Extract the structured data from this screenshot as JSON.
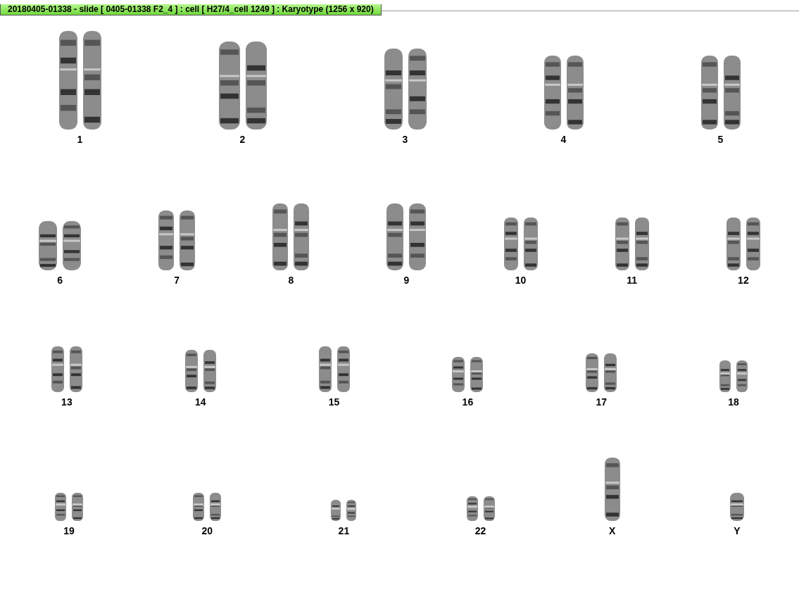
{
  "window": {
    "title": "20180405-01338 - slide [ 0405-01338 F2_4 ] : cell [ H27/4_cell 1249 ] : Karyotype  (1256 x 920)"
  },
  "karyotype": {
    "rows": [
      [
        {
          "label": "1",
          "kind": "pair"
        },
        {
          "label": "2",
          "kind": "pair"
        },
        {
          "label": "3",
          "kind": "pair"
        },
        {
          "label": "4",
          "kind": "pair"
        },
        {
          "label": "5",
          "kind": "pair"
        }
      ],
      [
        {
          "label": "6",
          "kind": "pair"
        },
        {
          "label": "7",
          "kind": "pair"
        },
        {
          "label": "8",
          "kind": "pair"
        },
        {
          "label": "9",
          "kind": "pair"
        },
        {
          "label": "10",
          "kind": "pair"
        },
        {
          "label": "11",
          "kind": "pair"
        },
        {
          "label": "12",
          "kind": "pair"
        }
      ],
      [
        {
          "label": "13",
          "kind": "pair"
        },
        {
          "label": "14",
          "kind": "pair"
        },
        {
          "label": "15",
          "kind": "pair"
        },
        {
          "label": "16",
          "kind": "pair"
        },
        {
          "label": "17",
          "kind": "pair"
        },
        {
          "label": "18",
          "kind": "pair"
        }
      ],
      [
        {
          "label": "19",
          "kind": "pair"
        },
        {
          "label": "20",
          "kind": "pair"
        },
        {
          "label": "21",
          "kind": "pair"
        },
        {
          "label": "22",
          "kind": "pair"
        },
        {
          "label": "X",
          "kind": "single"
        },
        {
          "label": "Y",
          "kind": "single"
        }
      ]
    ]
  }
}
